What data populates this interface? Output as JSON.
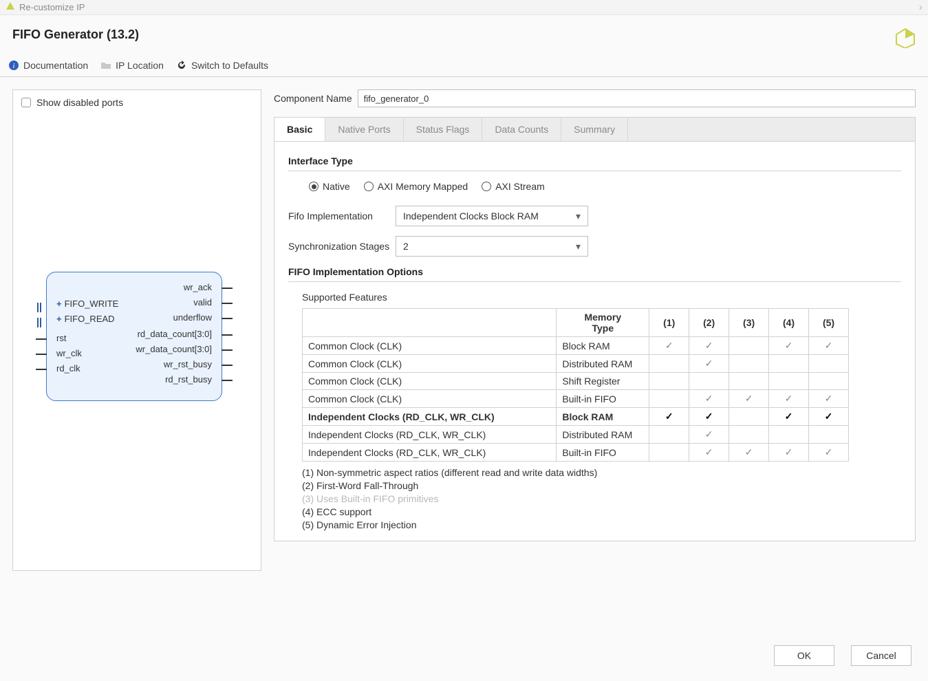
{
  "window": {
    "title": "Re-customize IP"
  },
  "header": {
    "title": "FIFO Generator (13.2)"
  },
  "toolbar": {
    "documentation": "Documentation",
    "ip_location": "IP Location",
    "switch_defaults": "Switch to Defaults"
  },
  "left": {
    "show_disabled_ports": "Show disabled ports",
    "block": {
      "fifo_write": "FIFO_WRITE",
      "fifo_read": "FIFO_READ",
      "rst": "rst",
      "wr_clk": "wr_clk",
      "rd_clk": "rd_clk",
      "wr_ack": "wr_ack",
      "valid": "valid",
      "underflow": "underflow",
      "rd_data_count": "rd_data_count[3:0]",
      "wr_data_count": "wr_data_count[3:0]",
      "wr_rst_busy": "wr_rst_busy",
      "rd_rst_busy": "rd_rst_busy"
    }
  },
  "component_name": {
    "label": "Component Name",
    "value": "fifo_generator_0"
  },
  "tabs": {
    "basic": "Basic",
    "native_ports": "Native Ports",
    "status_flags": "Status Flags",
    "data_counts": "Data Counts",
    "summary": "Summary"
  },
  "basic": {
    "interface_type_heading": "Interface Type",
    "radios": {
      "native": "Native",
      "axi_mm": "AXI Memory Mapped",
      "axi_stream": "AXI Stream"
    },
    "fifo_impl_label": "Fifo Implementation",
    "fifo_impl_value": "Independent Clocks Block RAM",
    "sync_stages_label": "Synchronization Stages",
    "sync_stages_value": "2",
    "fifo_options_heading": "FIFO Implementation Options",
    "supported_features": "Supported Features",
    "table": {
      "headers": {
        "mem_type": "Memory\nType",
        "c1": "(1)",
        "c2": "(2)",
        "c3": "(3)",
        "c4": "(4)",
        "c5": "(5)"
      },
      "rows": [
        {
          "name": "Common Clock (CLK)",
          "mem": "Block RAM",
          "m": [
            "l",
            "l",
            "",
            "l",
            "l"
          ],
          "bold": false
        },
        {
          "name": "Common Clock (CLK)",
          "mem": "Distributed RAM",
          "m": [
            "",
            "l",
            "",
            "",
            ""
          ],
          "bold": false
        },
        {
          "name": "Common Clock (CLK)",
          "mem": "Shift Register",
          "m": [
            "",
            "",
            "",
            "",
            ""
          ],
          "bold": false
        },
        {
          "name": "Common Clock (CLK)",
          "mem": "Built-in FIFO",
          "m": [
            "",
            "l",
            "l",
            "l",
            "l"
          ],
          "bold": false
        },
        {
          "name": "Independent Clocks (RD_CLK, WR_CLK)",
          "mem": "Block RAM",
          "m": [
            "s",
            "s",
            "",
            "s",
            "s"
          ],
          "bold": true
        },
        {
          "name": "Independent Clocks (RD_CLK, WR_CLK)",
          "mem": "Distributed RAM",
          "m": [
            "",
            "l",
            "",
            "",
            ""
          ],
          "bold": false
        },
        {
          "name": "Independent Clocks (RD_CLK, WR_CLK)",
          "mem": "Built-in FIFO",
          "m": [
            "",
            "l",
            "l",
            "l",
            "l"
          ],
          "bold": false
        }
      ]
    },
    "legend": {
      "l1": "(1) Non-symmetric aspect ratios (different read and write data widths)",
      "l2": "(2) First-Word Fall-Through",
      "l3": "(3) Uses Built-in FIFO primitives",
      "l4": "(4) ECC support",
      "l5": "(5) Dynamic Error Injection"
    }
  },
  "footer": {
    "ok": "OK",
    "cancel": "Cancel"
  }
}
